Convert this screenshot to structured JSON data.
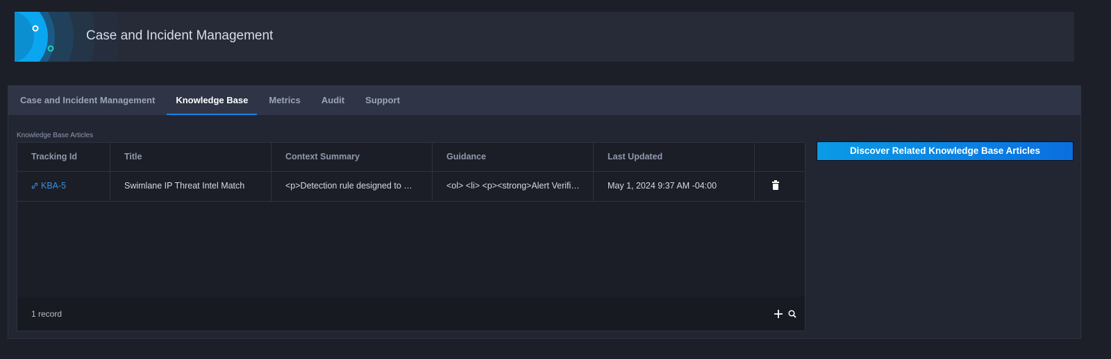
{
  "header": {
    "title": "Case and Incident Management"
  },
  "tabs": [
    {
      "label": "Case and Incident Management",
      "active": false
    },
    {
      "label": "Knowledge Base",
      "active": true
    },
    {
      "label": "Metrics",
      "active": false
    },
    {
      "label": "Audit",
      "active": false
    },
    {
      "label": "Support",
      "active": false
    }
  ],
  "section": {
    "label": "Knowledge Base Articles"
  },
  "table": {
    "columns": [
      "Tracking Id",
      "Title",
      "Context Summary",
      "Guidance",
      "Last Updated"
    ],
    "rows": [
      {
        "tracking_id": "KBA-5",
        "title": "Swimlane IP Threat Intel Match",
        "context_summary": "<p>Detection rule designed to …",
        "guidance": "<ol> <li> <p><strong>Alert Verifi…",
        "last_updated": "May 1, 2024 9:37 AM -04:00"
      }
    ],
    "record_count": "1 record"
  },
  "actions": {
    "discover_label": "Discover Related Knowledge Base Articles"
  },
  "colors": {
    "accent": "#1c7fe6",
    "link": "#3b8fe8",
    "bg": "#1c1f27"
  }
}
